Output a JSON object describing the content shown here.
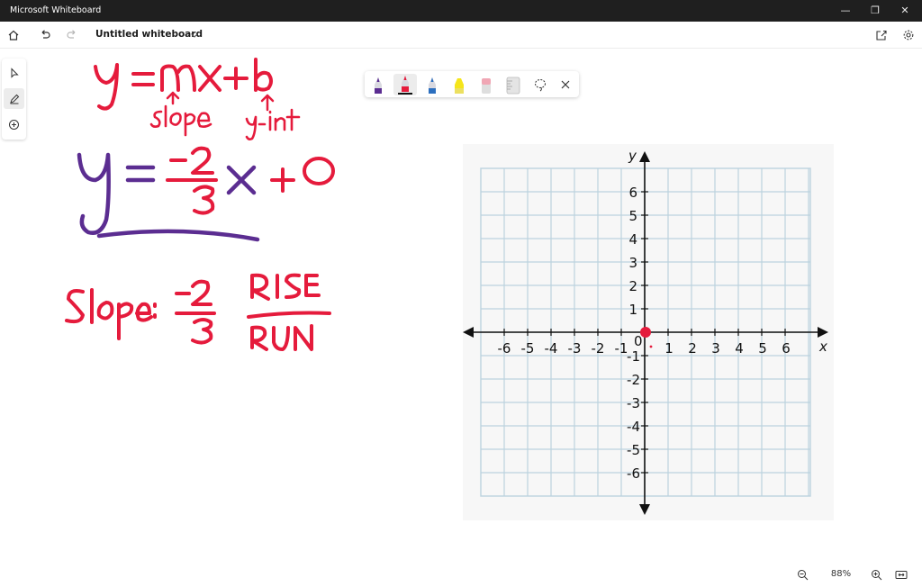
{
  "app": {
    "title": "Microsoft Whiteboard"
  },
  "window_controls": {
    "minimize": "—",
    "maximize": "❐",
    "close": "✕"
  },
  "toolbar": {
    "board_title": "Untitled whiteboard"
  },
  "zoom": {
    "level": "88%"
  },
  "pens": [
    {
      "name": "purple-pen",
      "color": "#5b2d91"
    },
    {
      "name": "red-pen",
      "color": "#e51b3c",
      "selected": true
    },
    {
      "name": "blue-pen",
      "color": "#2c6fbf"
    },
    {
      "name": "highlighter",
      "color": "#f5e51a"
    },
    {
      "name": "eraser",
      "color": "#f0a6b4"
    },
    {
      "name": "ruler",
      "color": "#cfcfcf"
    }
  ],
  "ink": {
    "line1": "y = mx + b",
    "label_slope": "slope",
    "label_yint": "y-int",
    "line2": "y = -2/3 x + 0",
    "line3_prefix": "Slope:",
    "line3_fraction": "-2/3",
    "rise": "RISE",
    "run": "RUN"
  },
  "graph": {
    "x_axis_label": "x",
    "y_axis_label": "y",
    "x_ticks_neg": [
      "-6",
      "-5",
      "-4",
      "-3",
      "-2",
      "-1"
    ],
    "x_ticks_pos": [
      "1",
      "2",
      "3",
      "4",
      "5",
      "6"
    ],
    "y_ticks_pos": [
      "6",
      "5",
      "4",
      "3",
      "2",
      "1"
    ],
    "y_ticks_neg": [
      "-1",
      "-2",
      "-3",
      "-4",
      "-5",
      "-6"
    ],
    "origin": "0",
    "plotted_point": {
      "x": 0,
      "y": 0
    }
  }
}
